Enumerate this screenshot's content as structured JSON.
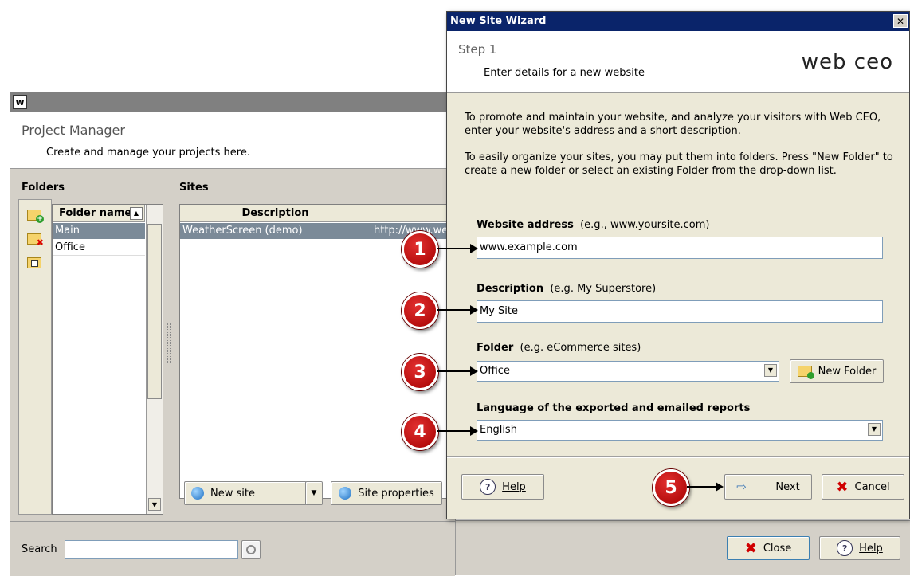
{
  "project_manager": {
    "title": "Project Manager",
    "subtitle": "Create and manage your projects here.",
    "folders_header": "Folders",
    "folder_col": "Folder name",
    "folders": [
      "Main",
      "Office"
    ],
    "sites_header": "Sites",
    "desc_col": "Description",
    "sites": [
      {
        "description": "WeatherScreen (demo)",
        "url": "http://www.wea"
      }
    ],
    "new_site_label": "New site",
    "site_props_label": "Site properties",
    "search_label": "Search",
    "search_value": "",
    "close_label": "Close",
    "help_label": "Help"
  },
  "wizard": {
    "title": "New Site Wizard",
    "step": "Step 1",
    "step_desc": "Enter details for a new website",
    "logo": "web ceo",
    "intro1": "To promote and maintain your website, and analyze your visitors with Web CEO, enter your website's address and a short description.",
    "intro2": "To easily organize your sites, you may put them into folders. Press \"New Folder\" to create a new folder or select an existing Folder from the drop-down list.",
    "website_label": "Website address",
    "website_hint": "(e.g., www.yoursite.com)",
    "website_value": "www.example.com",
    "desc_label": "Description",
    "desc_hint": "(e.g. My Superstore)",
    "desc_value": "My Site",
    "folder_label": "Folder",
    "folder_hint": "(e.g. eCommerce sites)",
    "folder_value": "Office",
    "new_folder_label": "New Folder",
    "lang_label": "Language of the exported and emailed reports",
    "lang_value": "English",
    "help_label": "Help",
    "next_label": "Next",
    "cancel_label": "Cancel"
  },
  "callouts": [
    "1",
    "2",
    "3",
    "4",
    "5"
  ],
  "colors": {
    "titlebar": "#0a246a",
    "selection": "#7b8a98",
    "panel": "#d4d0c8",
    "accent_red": "#c00000"
  }
}
